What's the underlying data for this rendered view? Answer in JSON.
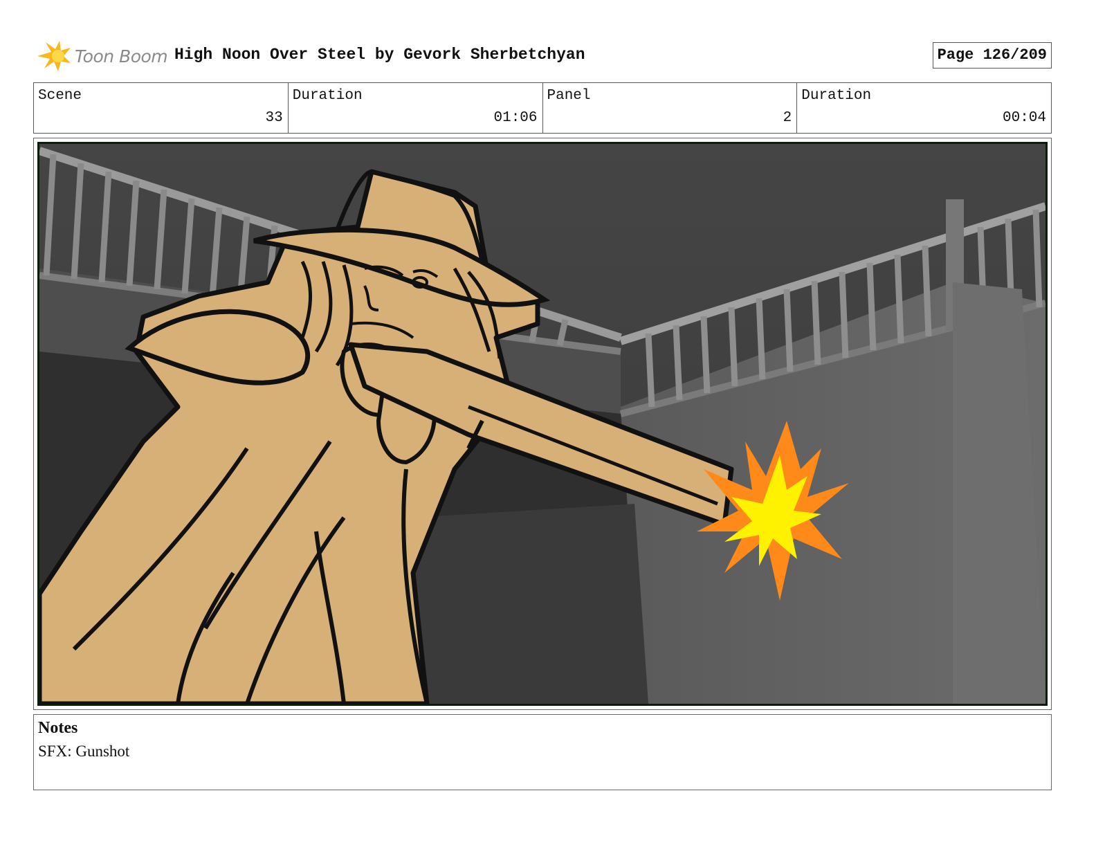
{
  "header": {
    "logo_text": "Toon Boom",
    "title": "High Noon Over Steel by Gevork Sherbetchyan",
    "page": "Page 126/209"
  },
  "info": {
    "scene_label": "Scene",
    "scene_value": "33",
    "scene_duration_label": "Duration",
    "scene_duration_value": "01:06",
    "panel_label": "Panel",
    "panel_value": "2",
    "panel_duration_label": "Duration",
    "panel_duration_value": "00:04"
  },
  "notes": {
    "title": "Notes",
    "body": "SFX: Gunshot"
  },
  "colors": {
    "figure": "#d6b077",
    "muzzle_flash_outer": "#ff8a1a",
    "muzzle_flash_inner": "#fff200",
    "background": "#3d3d3d"
  }
}
